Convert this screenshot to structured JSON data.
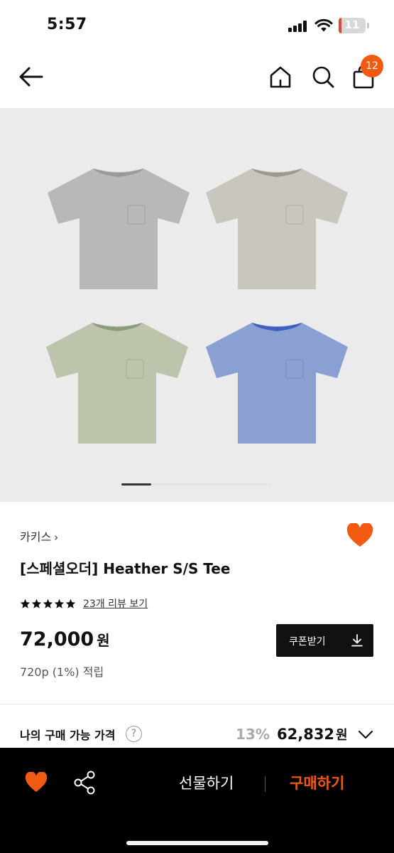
{
  "status_bar": {
    "time": "5:57",
    "battery": "11",
    "battery_level": 0.11
  },
  "nav": {
    "back_icon": "arrow-left-icon",
    "home_icon": "home-icon",
    "search_icon": "search-icon",
    "cart_icon": "shopping-bag-icon",
    "cart_count": "12"
  },
  "gallery": {
    "image": "four heather pocket t-shirts: grey, beige, sage green, blue",
    "shirt_colors": [
      "#b8b8b6",
      "#c9c6bd",
      "#bcc4ac",
      "#8aa0d2"
    ],
    "collar_colors": [
      "#9a9a98",
      "#9d9a8a",
      "#8e9a80",
      "#3e5fbf"
    ],
    "active_slide": 1,
    "slide_count": 5
  },
  "product": {
    "brand": "카키스",
    "brand_chevron": "›",
    "name": "[스페셜오더] Heather S/S Tee",
    "rating_stars": 5,
    "review_link": "23개 리뷰 보기",
    "price": "72,000",
    "price_unit": "원",
    "points": "720p (1%) 적립",
    "coupon_label": "쿠폰받기",
    "wishlisted": true
  },
  "my_price": {
    "label": "나의 구매 가능 가격",
    "help": "?",
    "discount": "13%",
    "price": "62,832",
    "unit": "원"
  },
  "bottom_bar": {
    "gift_label": "선물하기",
    "buy_label": "구매하기"
  },
  "colors": {
    "accent": "#f25a12",
    "heart": "#f25a12",
    "dark": "#111111"
  }
}
